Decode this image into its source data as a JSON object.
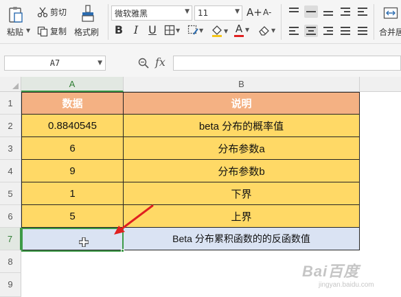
{
  "ribbon": {
    "paste_label": "粘贴",
    "cut_label": "剪切",
    "copy_label": "复制",
    "format_painter_label": "格式刷",
    "font_name": "微软雅黑",
    "font_size": "11",
    "bold_glyph": "B",
    "italic_glyph": "I",
    "underline_glyph": "U",
    "font_color_glyph": "A",
    "increase_font_glyph": "A+",
    "decrease_font_glyph": "A-",
    "merge_label": "合并居",
    "font_color_hex": "#e02020",
    "fill_color_hex": "#f5c518"
  },
  "formula_bar": {
    "name_box_value": "A7",
    "fx_label": "fx",
    "formula_value": ""
  },
  "sheet": {
    "columns": [
      "A",
      "B"
    ],
    "rows": [
      "1",
      "2",
      "3",
      "4",
      "5",
      "6",
      "7",
      "8",
      "9"
    ],
    "cells": {
      "A1": "数据",
      "B1": "说明",
      "A2": "0.8840545",
      "B2": "beta 分布的概率值",
      "A3": "6",
      "B3": "分布参数a",
      "A4": "9",
      "B4": "分布参数b",
      "A5": "1",
      "B5": "下界",
      "A6": "5",
      "B6": "上界",
      "A7": "",
      "B7": "Beta 分布累积函数的的反函数值"
    },
    "header_fill_hex": "#f4b183",
    "data_fill_hex": "#ffd966",
    "result_fill_hex": "#dae3f3",
    "selection_hex": "#3d9a47",
    "arrow_hex": "#e02020"
  },
  "watermark": {
    "logo": "Bai百度",
    "sub": "jingyan.baidu.com"
  }
}
